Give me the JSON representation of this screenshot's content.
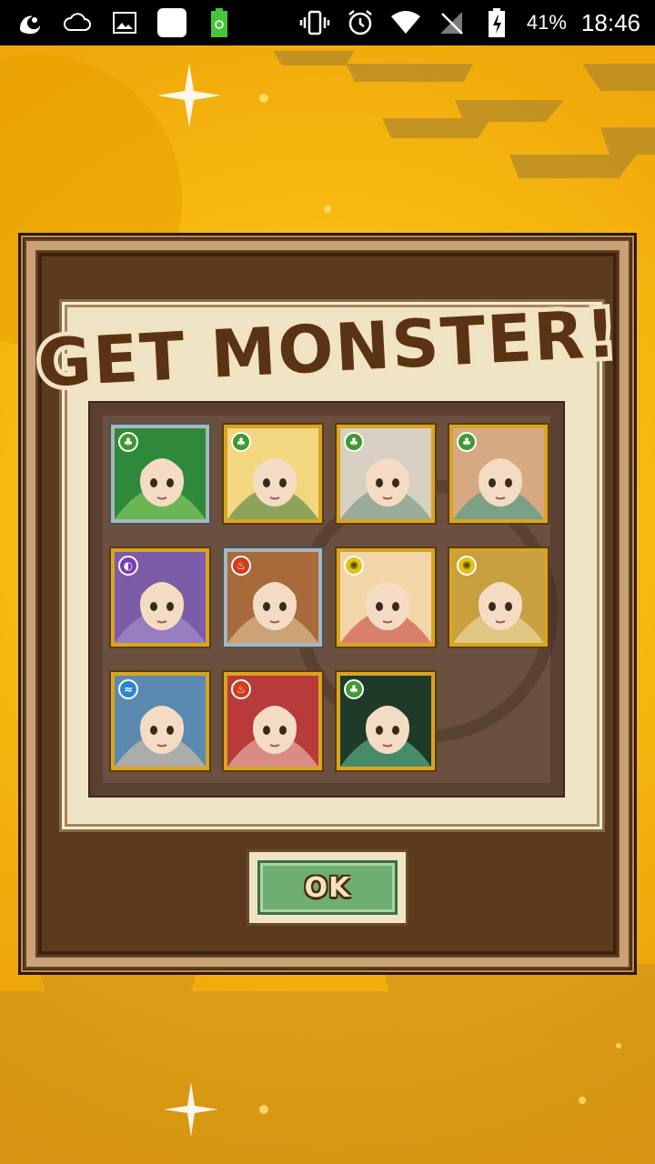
{
  "status_bar": {
    "battery_percent": "41%",
    "time": "18:46",
    "icons": [
      "uc-browser-icon",
      "cloud-icon",
      "gallery-icon",
      "white-square-icon",
      "battery-saver-icon",
      "vibrate-icon",
      "alarm-icon",
      "wifi-icon",
      "no-signal-icon",
      "battery-icon"
    ]
  },
  "dialog": {
    "title": "GET MONSTER!",
    "ok_label": "OK"
  },
  "monsters": [
    {
      "attribute": "wood",
      "frame": "silver",
      "palette": [
        "#2e8a3a",
        "#9fd86a"
      ]
    },
    {
      "attribute": "wood",
      "frame": "gold",
      "palette": [
        "#f2d680",
        "#3a7a3a"
      ]
    },
    {
      "attribute": "wood",
      "frame": "gold",
      "palette": [
        "#d8d0c2",
        "#6a8c78"
      ]
    },
    {
      "attribute": "wood",
      "frame": "gold",
      "palette": [
        "#d6a980",
        "#2f9b8a"
      ]
    },
    {
      "attribute": "dark",
      "frame": "gold",
      "palette": [
        "#7a5ca8",
        "#b09ad2"
      ]
    },
    {
      "attribute": "fire",
      "frame": "silver",
      "palette": [
        "#a86a3a",
        "#e8d2a8"
      ]
    },
    {
      "attribute": "light",
      "frame": "gold",
      "palette": [
        "#f2d6a8",
        "#c23a3a"
      ]
    },
    {
      "attribute": "light",
      "frame": "gold",
      "palette": [
        "#c8a040",
        "#f2e6b8"
      ]
    },
    {
      "attribute": "water",
      "frame": "gold",
      "palette": [
        "#5a8ab0",
        "#f0c8a8"
      ]
    },
    {
      "attribute": "fire",
      "frame": "gold",
      "palette": [
        "#b83a3a",
        "#f2d0c0"
      ]
    },
    {
      "attribute": "wood",
      "frame": "gold",
      "palette": [
        "#1e3a28",
        "#6ad0a0"
      ]
    }
  ],
  "attribute_glyphs": {
    "wood": "♣",
    "dark": "◐",
    "fire": "♨",
    "light": "✺",
    "water": "≈"
  }
}
